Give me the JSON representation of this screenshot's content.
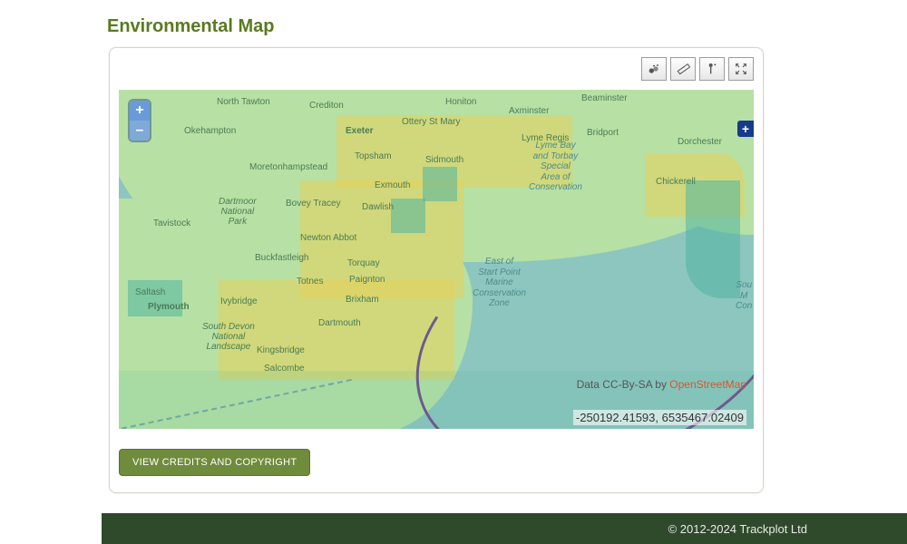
{
  "title": "Environmental Map",
  "toolbar": {
    "layers_name": "layers-icon",
    "ruler_name": "ruler-icon",
    "marker_name": "marker-icon",
    "expand_name": "fullscreen-icon"
  },
  "zoom": {
    "in": "+",
    "out": "–"
  },
  "floating_plus": "+",
  "map_labels": {
    "north_tawton": "North Tawton",
    "crediton": "Crediton",
    "honiton": "Honiton",
    "axminster": "Axminster",
    "beaminster": "Beaminster",
    "okehampton": "Okehampton",
    "exeter": "Exeter",
    "ottery": "Ottery St Mary",
    "lyme_regis": "Lyme Regis",
    "bridport": "Bridport",
    "dorchester": "Dorchester",
    "moreton": "Moretonhampstead",
    "topsham": "Topsham",
    "sidmouth": "Sidmouth",
    "chickerell": "Chickerell",
    "tavistock": "Tavistock",
    "bovey": "Bovey Tracey",
    "exmouth": "Exmouth",
    "dawlish": "Dawlish",
    "newton_abbot": "Newton Abbot",
    "buckfastleigh": "Buckfastleigh",
    "torquay": "Torquay",
    "totnes": "Totnes",
    "paignton": "Paignton",
    "saltash": "Saltash",
    "plymouth": "Plymouth",
    "ivybridge": "Ivybridge",
    "brixham": "Brixham",
    "dartmouth": "Dartmouth",
    "kingsbridge": "Kingsbridge",
    "salcombe": "Salcombe",
    "dartmoor": "Dartmoor\nNational\nPark",
    "south_devon": "South Devon\nNational\nLandscape",
    "lyme_bay": "Lyme Bay\nand Torbay\nSpecial\nArea of\nConservation",
    "start_point": "East of\nStart Point\nMarine\nConservation\nZone",
    "sou_m_co": "Sou\nM\nCon"
  },
  "attribution": {
    "prefix": "Data CC-By-SA by ",
    "link_text": "OpenStreetMap"
  },
  "coords": "-250192.41593, 6535467.02409",
  "credits_button": "VIEW CREDITS AND COPYRIGHT",
  "footer": "© 2012-2024 Trackplot Ltd"
}
